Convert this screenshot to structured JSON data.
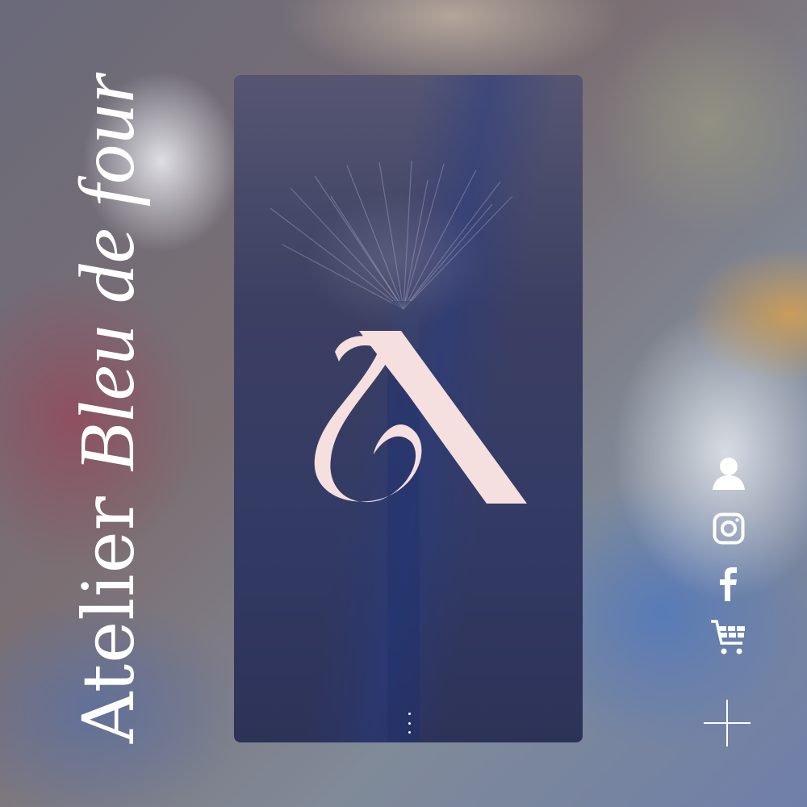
{
  "brand": {
    "title_regular": "Atelier",
    "title_italic": "Bleu de four",
    "logo_letter": "A",
    "logo_color": "#f5dfdf"
  },
  "card": {
    "menu_icon": "vertical-dots-icon",
    "background_color": "#363a60"
  },
  "social": [
    {
      "name": "account",
      "icon": "user-icon"
    },
    {
      "name": "instagram",
      "icon": "instagram-icon"
    },
    {
      "name": "facebook",
      "icon": "facebook-icon"
    },
    {
      "name": "cart",
      "icon": "cart-icon"
    }
  ],
  "expand": {
    "icon": "plus-icon"
  }
}
